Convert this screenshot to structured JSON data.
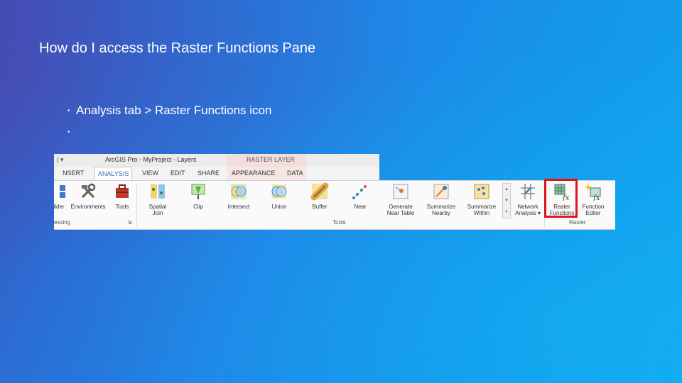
{
  "slide": {
    "title": "How do I access the Raster Functions Pane",
    "bullets": [
      "Analysis tab > Raster Functions icon",
      ""
    ]
  },
  "ribbon": {
    "window_title": "ArcGIS Pro - MyProject - Layers",
    "quick_access": "| ▾",
    "contextual_title": "RASTER LAYER",
    "tabs": [
      "NSERT",
      "ANALYSIS",
      "VIEW",
      "EDIT",
      "SHARE",
      "APPEARANCE",
      "DATA"
    ],
    "active_tab": "ANALYSIS",
    "geoprocessing_tools": [
      {
        "label": "ilder",
        "icon": "modelbuilder-icon"
      },
      {
        "label": "Environments",
        "icon": "wrench-hammer-icon"
      },
      {
        "label": "Tools",
        "icon": "toolbox-icon"
      }
    ],
    "tools": [
      {
        "label": "Spatial\nJoin",
        "icon": "spatial-join-icon"
      },
      {
        "label": "Clip",
        "icon": "clip-icon"
      },
      {
        "label": "Intersect",
        "icon": "intersect-icon"
      },
      {
        "label": "Union",
        "icon": "union-icon"
      },
      {
        "label": "Buffer",
        "icon": "buffer-icon"
      },
      {
        "label": "Near",
        "icon": "near-icon"
      },
      {
        "label": "Generate\nNear Table",
        "icon": "near-table-icon"
      },
      {
        "label": "Summarize\nNearby",
        "icon": "summarize-nearby-icon"
      },
      {
        "label": "Summarize\nWithin",
        "icon": "summarize-within-icon"
      }
    ],
    "network_analysis": "Network\nAnalysis ▾",
    "raster_tools": [
      {
        "label": "Raster\nFunctions",
        "icon": "raster-functions-icon"
      },
      {
        "label": "Function\nEditor",
        "icon": "function-editor-icon"
      }
    ],
    "group_labels": {
      "geoprocessing": "essing",
      "tools": "Tools",
      "raster": "Raster"
    },
    "highlight_color": "#e0141d"
  }
}
